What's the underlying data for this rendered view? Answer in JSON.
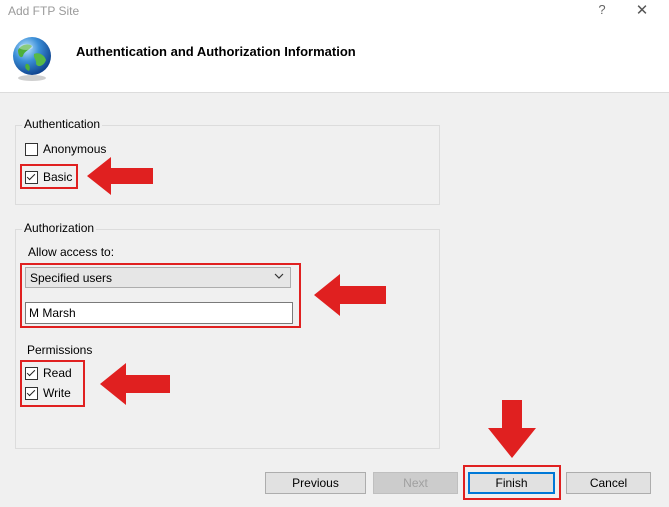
{
  "window": {
    "title": "Add FTP Site",
    "help_glyph": "?",
    "close_glyph": "✕"
  },
  "header": {
    "title": "Authentication and Authorization Information"
  },
  "authentication": {
    "group_label": "Authentication",
    "anonymous": {
      "label": "Anonymous",
      "checked": false
    },
    "basic": {
      "label": "Basic",
      "checked": true
    }
  },
  "authorization": {
    "group_label": "Authorization",
    "allow_access_label": "Allow access to:",
    "allow_access_selected": "Specified users",
    "users_value": "M Marsh",
    "permissions_label": "Permissions",
    "read": {
      "label": "Read",
      "checked": true
    },
    "write": {
      "label": "Write",
      "checked": true
    }
  },
  "buttons": {
    "previous": "Previous",
    "next": "Next",
    "finish": "Finish",
    "cancel": "Cancel"
  },
  "colors": {
    "annotation_red": "#e02020",
    "focus_blue": "#0078d7"
  }
}
